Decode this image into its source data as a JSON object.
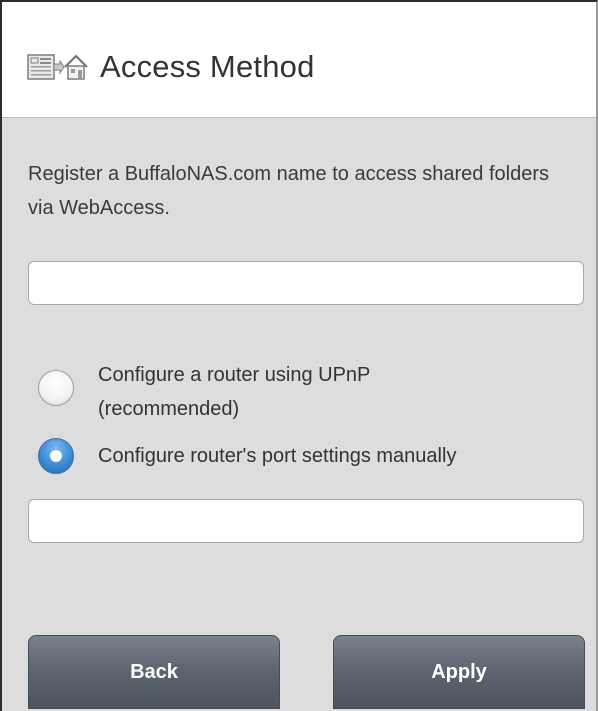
{
  "header": {
    "icon": "nas-webaccess-icon",
    "title": "Access Method"
  },
  "description": "Register a BuffaloNAS.com name to access shared folders via WebAccess.",
  "name_field": {
    "value": "",
    "placeholder": ""
  },
  "options": [
    {
      "line1": "Configure a router using UPnP",
      "line2": "(recommended)",
      "selected": false
    },
    {
      "line1": "Configure router's port settings manually",
      "selected": true
    }
  ],
  "port_field": {
    "value": "",
    "placeholder": ""
  },
  "buttons": {
    "back": "Back",
    "apply": "Apply"
  },
  "colors": {
    "button": "#5e6771",
    "radio_selected": "#3d8ad6",
    "background": "#dddddd"
  }
}
